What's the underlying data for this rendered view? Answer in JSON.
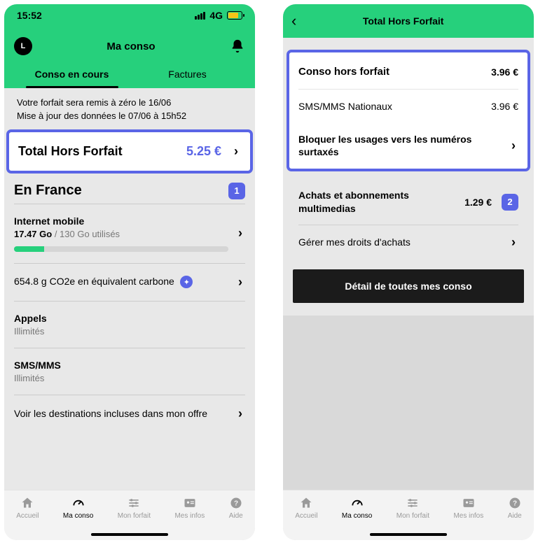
{
  "statusbar": {
    "time": "15:52",
    "network": "4G"
  },
  "screen1": {
    "avatar_initial": "L",
    "title": "Ma conso",
    "tabs": {
      "active": "Conso en cours",
      "inactive": "Factures"
    },
    "banner_line1": "Votre forfait sera remis à zéro le 16/06",
    "banner_line2": "Mise à jour des données le 07/06 à 15h52",
    "total_card": {
      "label": "Total Hors Forfait",
      "price": "5.25 €"
    },
    "france": {
      "title": "En France",
      "badge": "1",
      "internet": {
        "label": "Internet mobile",
        "used": "17.47 Go",
        "sep": " / ",
        "total": "130 Go",
        "suffix": " utilisés"
      },
      "carbon": "654.8 g CO2e en équivalent carbone",
      "appels": {
        "label": "Appels",
        "sub": "Illimités"
      },
      "sms": {
        "label": "SMS/MMS",
        "sub": "Illimités"
      },
      "destinations": "Voir les destinations incluses dans mon offre"
    }
  },
  "screen2": {
    "title": "Total Hors Forfait",
    "panel": {
      "head_label": "Conso hors forfait",
      "head_price": "3.96 €",
      "sms_label": "SMS/MMS Nationaux",
      "sms_price": "3.96 €",
      "block_label": "Bloquer les usages vers les numéros surtaxés"
    },
    "achats": {
      "label": "Achats et abonnements multimedias",
      "price": "1.29 €",
      "badge": "2"
    },
    "gerer": "Gérer mes droits d'achats",
    "detail_btn": "Détail de toutes mes conso"
  },
  "nav": {
    "accueil": "Accueil",
    "maconso": "Ma conso",
    "monforfait": "Mon forfait",
    "mesinfos": "Mes infos",
    "aide": "Aide"
  }
}
